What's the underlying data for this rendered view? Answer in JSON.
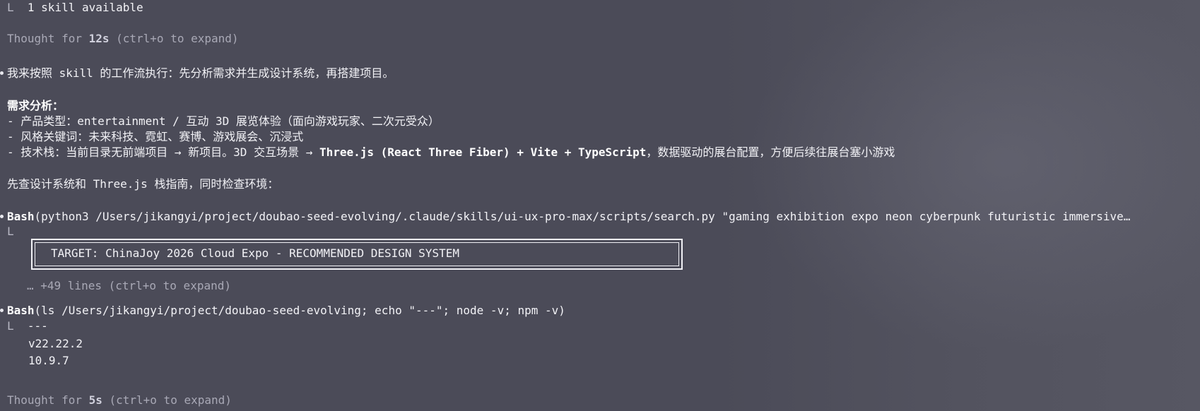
{
  "terminal": {
    "line_skill": "1 skill available",
    "tree_glyph": "L",
    "thought1": {
      "prefix": "Thought for ",
      "duration": "12s",
      "suffix": " (ctrl+o to expand)"
    },
    "intro": "我来按照 skill 的工作流执行：先分析需求并生成设计系统，再搭建项目。",
    "analysis_heading": "需求分析：",
    "analysis_items": [
      "- 产品类型：entertainment / 互动 3D 展览体验（面向游戏玩家、二次元受众）",
      "- 风格关键词：未来科技、霓虹、赛博、游戏展会、沉浸式"
    ],
    "tech_stack": {
      "prefix": "- 技术栈：当前目录无前端项目 → 新项目。3D 交互场景 → ",
      "bold": "Three.js (React Three Fiber) + Vite + TypeScript",
      "suffix": "，数据驱动的展台配置，方便后续往展台塞小游戏"
    },
    "check_line": "先查设计系统和 Three.js 栈指南，同时检查环境：",
    "bash1": {
      "tool": "Bash",
      "args": "(python3 /Users/jikangyi/project/doubao-seed-evolving/.claude/skills/ui-ux-pro-max/scripts/search.py \"gaming exhibition expo neon cyberpunk futuristic immersive…",
      "box_text": "TARGET: ChinaJoy 2026 Cloud Expo - RECOMMENDED DESIGN SYSTEM",
      "more": "… +49 lines (ctrl+o to expand)"
    },
    "bash2": {
      "tool": "Bash",
      "args": "(ls /Users/jikangyi/project/doubao-seed-evolving; echo \"---\"; node -v; npm -v)",
      "output": [
        "---",
        "v22.22.2",
        "10.9.7"
      ]
    },
    "thought2": {
      "prefix": "Thought for ",
      "duration": "5s",
      "suffix": " (ctrl+o to expand)"
    }
  }
}
